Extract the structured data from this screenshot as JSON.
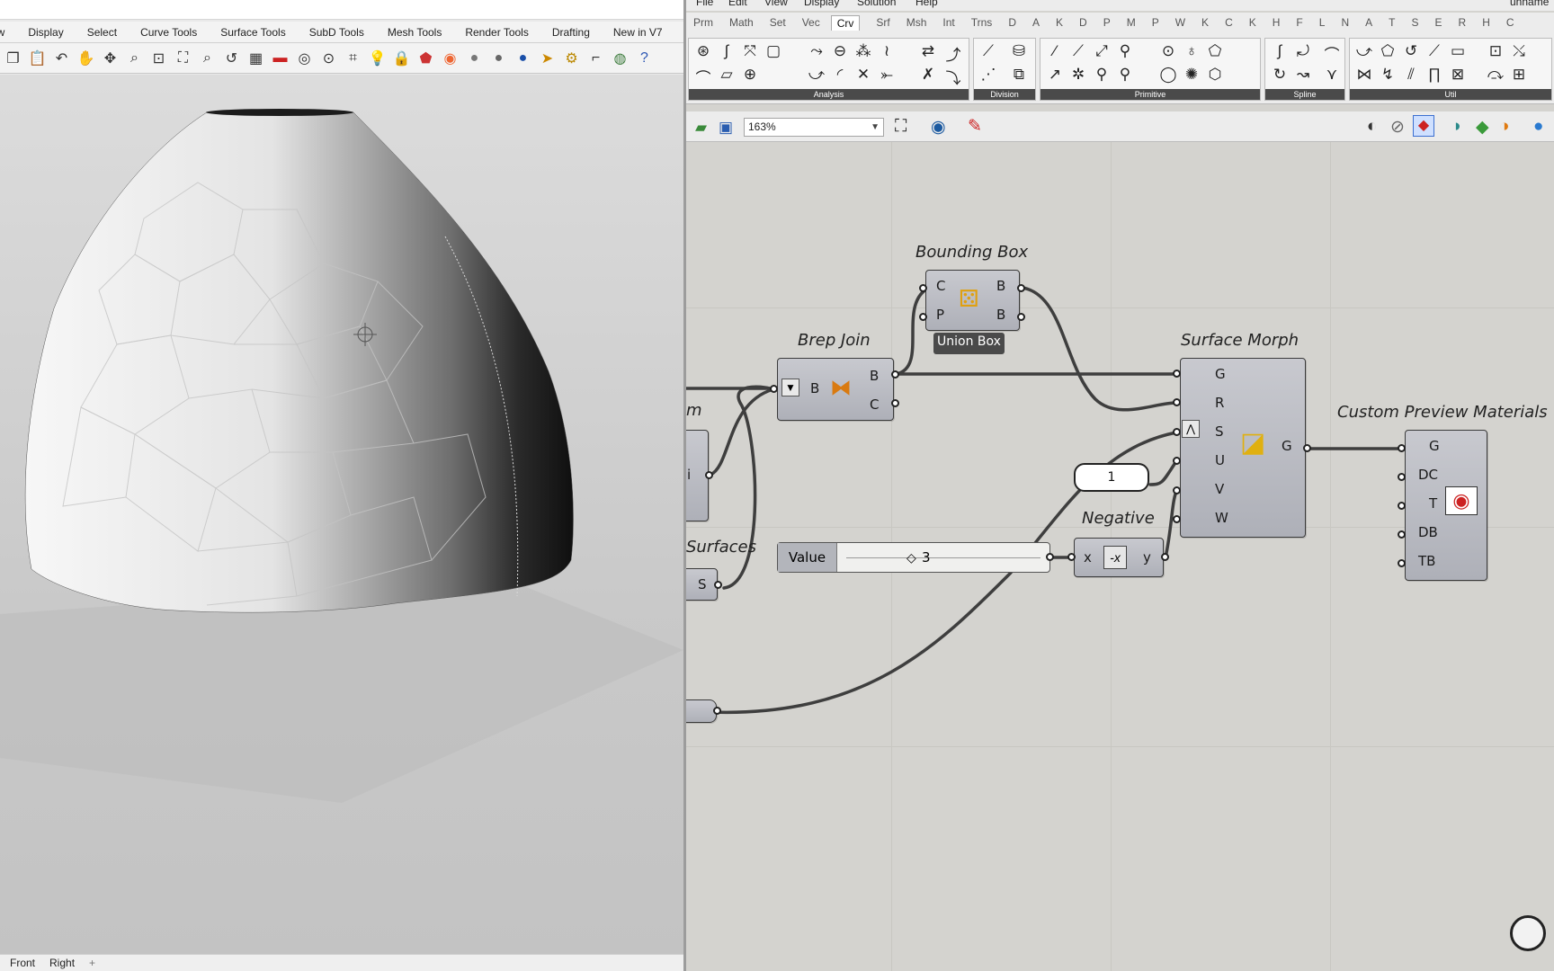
{
  "rhino": {
    "menu_tabs": [
      "ew",
      "Display",
      "Select",
      "Curve Tools",
      "Surface Tools",
      "SubD Tools",
      "Mesh Tools",
      "Render Tools",
      "Drafting",
      "New in V7"
    ],
    "viewport_tabs": [
      "Front",
      "Right"
    ],
    "add_tab_symbol": "+"
  },
  "grasshopper": {
    "menu": [
      "File",
      "Edit",
      "View",
      "Display",
      "Solution",
      "Help"
    ],
    "document_title": "unname",
    "tabs": [
      "Prm",
      "Math",
      "Set",
      "Vec",
      "Crv",
      "Srf",
      "Msh",
      "Int",
      "Trns",
      "D",
      "A",
      "K",
      "D",
      "P",
      "M",
      "P",
      "W",
      "K",
      "C",
      "K",
      "H",
      "F",
      "L",
      "N",
      "A",
      "T",
      "S",
      "E",
      "R",
      "H",
      "C"
    ],
    "active_tab": "Crv",
    "ribbon_groups": [
      "Analysis",
      "Division",
      "Primitive",
      "Spline",
      "Util"
    ],
    "zoom": "163%",
    "components": {
      "bounding_box": {
        "title": "Bounding Box",
        "inputs": [
          "C",
          "P"
        ],
        "outputs": [
          "B",
          "B"
        ],
        "tooltip": "Union Box"
      },
      "brep_join": {
        "title": "Brep Join",
        "input": "B",
        "outputs": [
          "B",
          "C"
        ]
      },
      "surface_morph": {
        "title": "Surface Morph",
        "inputs": [
          "G",
          "R",
          "S",
          "U",
          "V",
          "W"
        ],
        "output": "G"
      },
      "custom_preview": {
        "title": "Custom Preview Materials",
        "inputs": [
          "G",
          "DC",
          "T",
          "DB",
          "TB"
        ]
      },
      "negative": {
        "title": "Negative",
        "input": "x",
        "output": "y"
      },
      "value_slider": {
        "label": "Value",
        "value": "3"
      },
      "number_panel": {
        "value": "1"
      },
      "surfaces_param": {
        "title": "Surfaces",
        "label": "S"
      },
      "partial_left_label": "m",
      "partial_left_port": "i"
    }
  },
  "colors": {
    "canvas": "#d4d3cf",
    "component": "#b8bac1",
    "wire": "#3e3e3e",
    "tooltip": "#4a4a4a"
  }
}
